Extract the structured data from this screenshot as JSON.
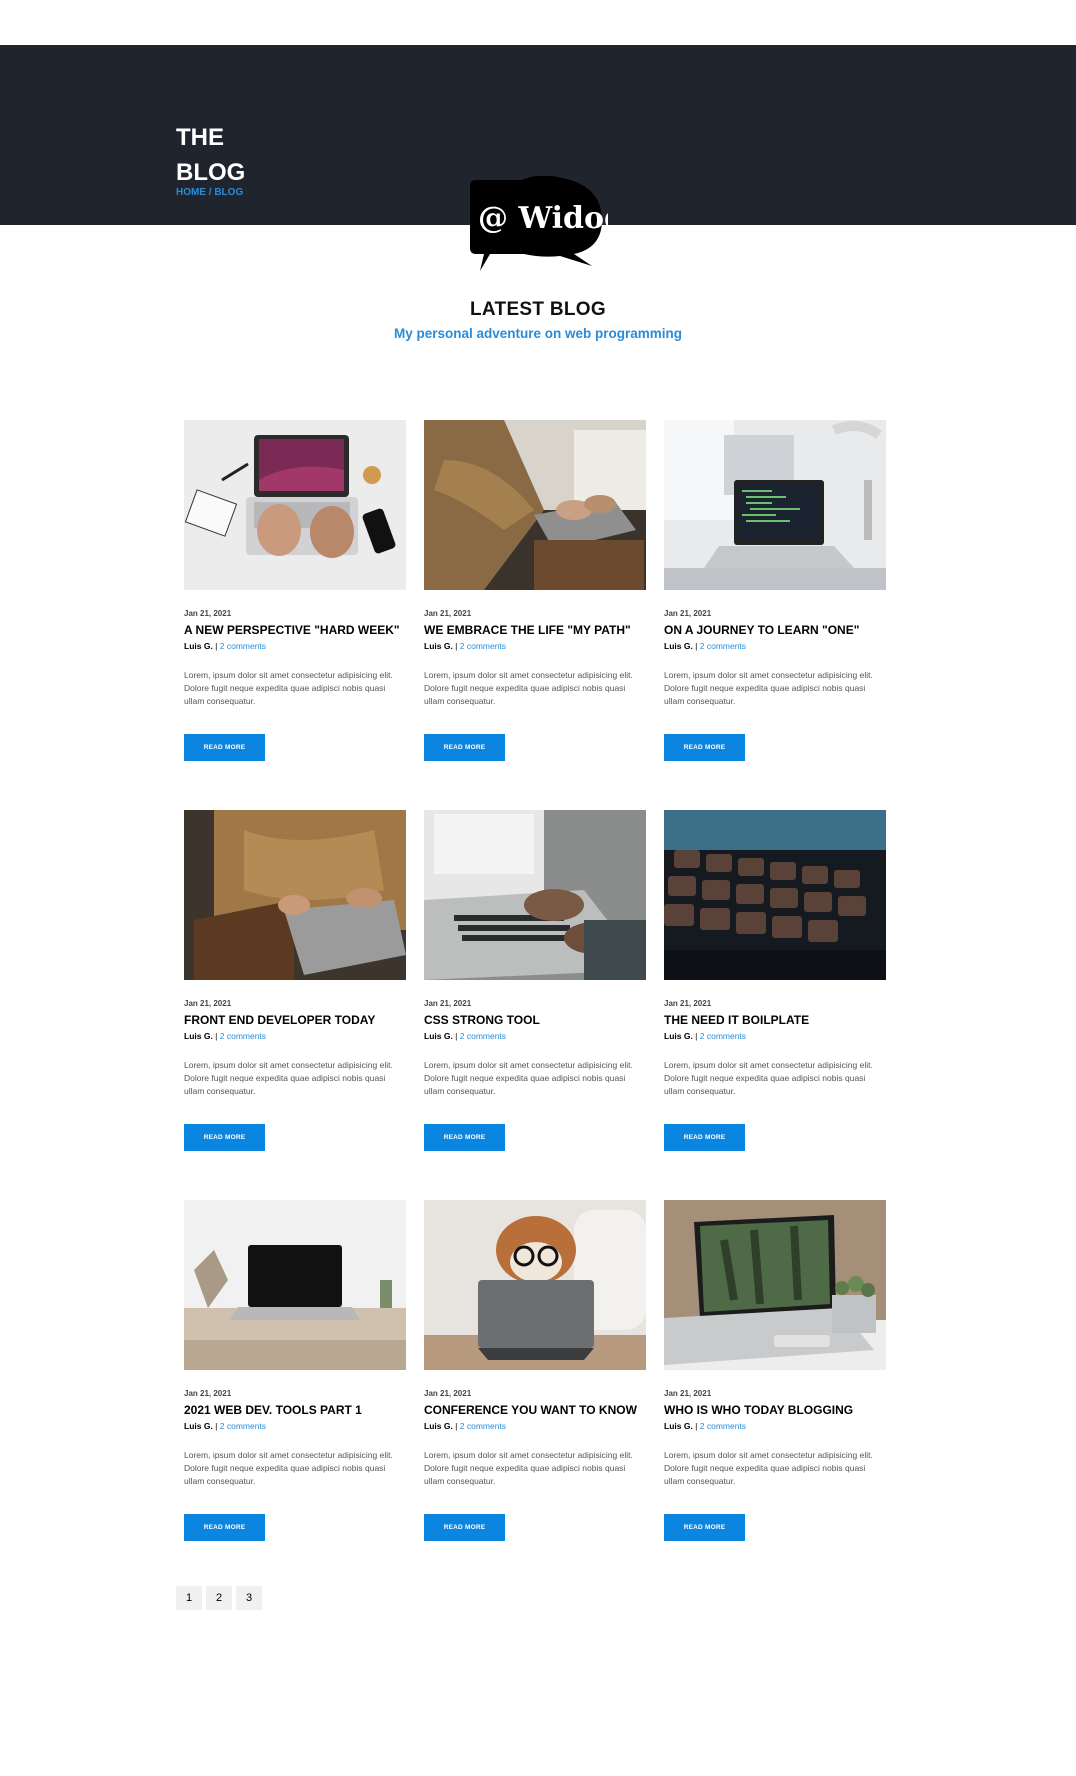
{
  "hero": {
    "title_line1": "THE",
    "title_line2": "BLOG",
    "breadcrumb": "HOME / BLOG"
  },
  "logo": {
    "text": "@ Widogv"
  },
  "section": {
    "title": "LATEST BLOG",
    "subtitle": "My personal adventure on web programming"
  },
  "posts": [
    {
      "date": "Jan 21, 2021",
      "title": "A NEW PERSPECTIVE \"HARD WEEK\"",
      "author": "Luis G.",
      "separator": " | ",
      "comments": "2 comments",
      "excerpt": "Lorem, ipsum dolor sit amet consectetur adipisicing elit. Dolore fugit neque expedita quae adipisci nobis quasi ullam consequatur.",
      "button": "READ MORE",
      "image": "laptop-top-view"
    },
    {
      "date": "Jan 21, 2021",
      "title": "WE EMBRACE THE LIFE \"MY PATH\"",
      "author": "Luis G.",
      "separator": " | ",
      "comments": "2 comments",
      "excerpt": "Lorem, ipsum dolor sit amet consectetur adipisicing elit. Dolore fugit neque expedita quae adipisci nobis quasi ullam consequatur.",
      "button": "READ MORE",
      "image": "person-typing-sweater"
    },
    {
      "date": "Jan 21, 2021",
      "title": "ON A JOURNEY TO LEARN \"ONE\"",
      "author": "Luis G.",
      "separator": " | ",
      "comments": "2 comments",
      "excerpt": "Lorem, ipsum dolor sit amet consectetur adipisicing elit. Dolore fugit neque expedita quae adipisci nobis quasi ullam consequatur.",
      "button": "READ MORE",
      "image": "desk-laptop-code"
    },
    {
      "date": "Jan 21, 2021",
      "title": "FRONT END DEVELOPER TODAY",
      "author": "Luis G.",
      "separator": " | ",
      "comments": "2 comments",
      "excerpt": "Lorem, ipsum dolor sit amet consectetur adipisicing elit. Dolore fugit neque expedita quae adipisci nobis quasi ullam consequatur.",
      "button": "READ MORE",
      "image": "person-laptop-lap"
    },
    {
      "date": "Jan 21, 2021",
      "title": "CSS STRONG TOOL",
      "author": "Luis G.",
      "separator": " | ",
      "comments": "2 comments",
      "excerpt": "Lorem, ipsum dolor sit amet consectetur adipisicing elit. Dolore fugit neque expedita quae adipisci nobis quasi ullam consequatur.",
      "button": "READ MORE",
      "image": "hands-typing-laptop"
    },
    {
      "date": "Jan 21, 2021",
      "title": "THE NEED IT BOILPLATE",
      "author": "Luis G.",
      "separator": " | ",
      "comments": "2 comments",
      "excerpt": "Lorem, ipsum dolor sit amet consectetur adipisicing elit. Dolore fugit neque expedita quae adipisci nobis quasi ullam consequatur.",
      "button": "READ MORE",
      "image": "keyboard-closeup"
    },
    {
      "date": "Jan 21, 2021",
      "title": "2021 WEB DEV. TOOLS PART 1",
      "author": "Luis G.",
      "separator": " | ",
      "comments": "2 comments",
      "excerpt": "Lorem, ipsum dolor sit amet consectetur adipisicing elit. Dolore fugit neque expedita quae adipisci nobis quasi ullam consequatur.",
      "button": "READ MORE",
      "image": "laptop-on-table"
    },
    {
      "date": "Jan 21, 2021",
      "title": "CONFERENCE YOU WANT TO KNOW",
      "author": "Luis G.",
      "separator": " | ",
      "comments": "2 comments",
      "excerpt": "Lorem, ipsum dolor sit amet consectetur adipisicing elit. Dolore fugit neque expedita quae adipisci nobis quasi ullam consequatur.",
      "button": "READ MORE",
      "image": "dog-with-tablet"
    },
    {
      "date": "Jan 21, 2021",
      "title": "WHO IS WHO TODAY BLOGGING",
      "author": "Luis G.",
      "separator": " | ",
      "comments": "2 comments",
      "excerpt": "Lorem, ipsum dolor sit amet consectetur adipisicing elit. Dolore fugit neque expedita quae adipisci nobis quasi ullam consequatur.",
      "button": "READ MORE",
      "image": "laptop-with-plant"
    }
  ],
  "pagination": [
    "1",
    "2",
    "3"
  ],
  "colors": {
    "hero_bg": "#1f242d",
    "accent": "#2a8cd8",
    "button": "#0b86e0"
  }
}
